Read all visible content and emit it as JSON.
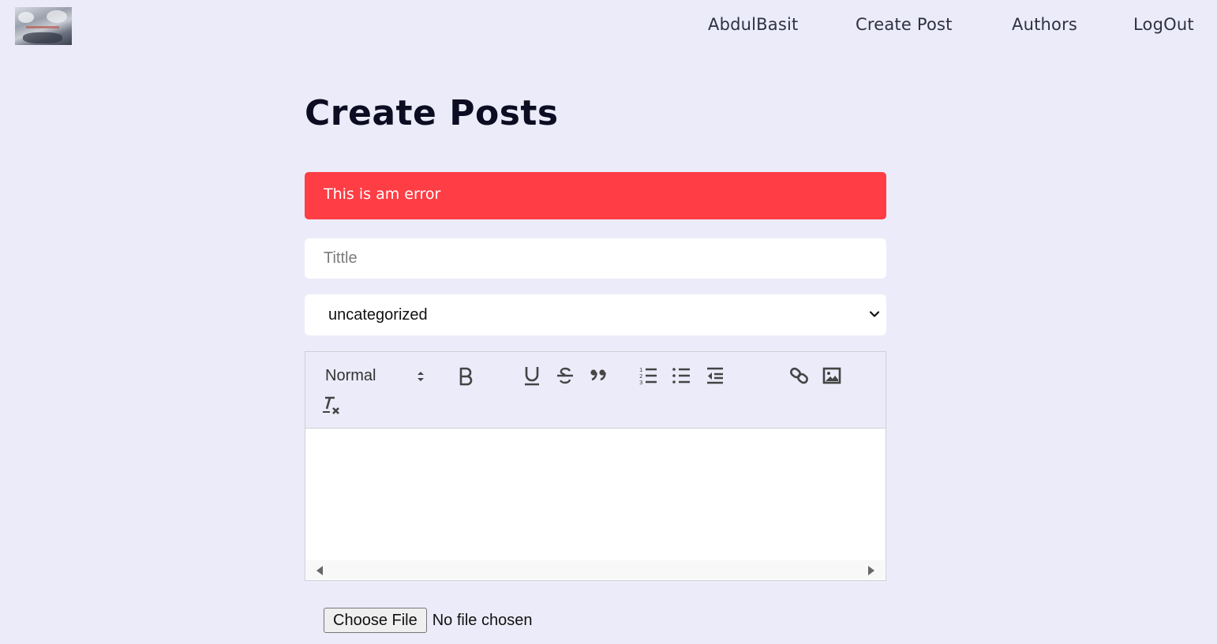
{
  "nav": {
    "logo_alt": "logo",
    "links": [
      "AbdulBasit",
      "Create Post",
      "Authors",
      "LogOut"
    ]
  },
  "main": {
    "title": "Create Posts",
    "error_message": "This is am error",
    "title_input": {
      "placeholder": "Tittle",
      "value": ""
    },
    "category_select": {
      "selected": "uncategorized"
    },
    "editor": {
      "header_select": "Normal",
      "tools": [
        "bold",
        "underline",
        "strike",
        "blockquote",
        "ordered-list",
        "bullet-list",
        "outdent",
        "link",
        "image",
        "clean"
      ]
    },
    "file_input": {
      "button_label": "Choose File",
      "status": "No file chosen"
    }
  },
  "colors": {
    "background": "#ecebf9",
    "error": "#ff3d44",
    "text_dark": "#0c0c22"
  }
}
